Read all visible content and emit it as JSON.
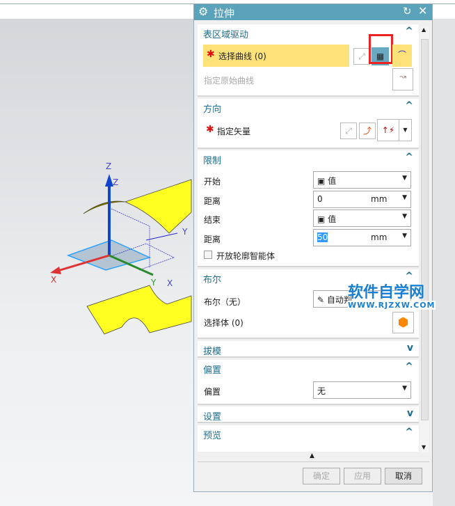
{
  "dialog": {
    "title": "拉伸"
  },
  "sections": {
    "surface": {
      "title": "表区域驱动",
      "select_curve": "选择曲线 (0)",
      "origin_curve": "指定原始曲线"
    },
    "direction": {
      "title": "方向",
      "vector": "指定矢量"
    },
    "limits": {
      "title": "限制",
      "start_label": "开始",
      "start_value": "值",
      "dist1_label": "距离",
      "dist1_value": "0",
      "unit": "mm",
      "end_label": "结束",
      "end_value": "值",
      "dist2_label": "距离",
      "dist2_value": "50",
      "open_profile": "开放轮廓智能体"
    },
    "boolean": {
      "title": "布尔",
      "bool_label": "布尔（无）",
      "bool_value": "自动判",
      "select_body": "选择体 (0)"
    },
    "draft": {
      "title": "拔模"
    },
    "offset": {
      "title": "偏置",
      "offset_label": "偏置",
      "offset_value": "无"
    },
    "settings": {
      "title": "设置"
    },
    "preview": {
      "title": "预览"
    }
  },
  "buttons": {
    "ok": "确定",
    "apply": "应用",
    "cancel": "取消"
  },
  "watermark": {
    "cn": "软件自学网",
    "url": "WWW.RJZXW.COM"
  },
  "axes": {
    "x": "X",
    "y": "Y",
    "z": "Z"
  }
}
